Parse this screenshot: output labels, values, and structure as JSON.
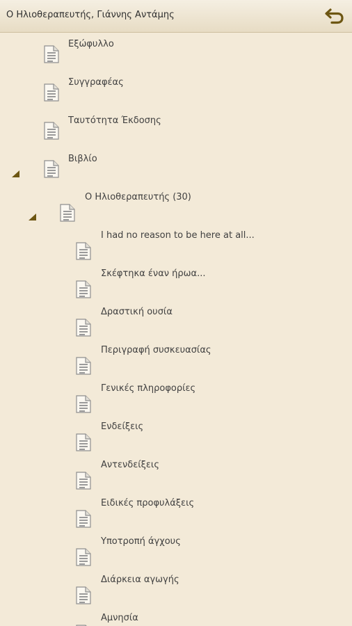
{
  "header": {
    "title": "Ο Ηλιοθεραπευτής, Γιάννης Αντάμης",
    "back_icon": "back-arrow-icon",
    "accent_color": "#6d5612"
  },
  "toc": {
    "items": [
      {
        "label": "Εξώφυλλο",
        "level": 0,
        "expanded": null
      },
      {
        "label": "Συγγραφέας",
        "level": 0,
        "expanded": null
      },
      {
        "label": "Ταυτότητα Έκδοσης",
        "level": 0,
        "expanded": null
      },
      {
        "label": "Βιβλίο",
        "level": 0,
        "expanded": true
      },
      {
        "label": "Ο Ηλιοθεραπευτής (30)",
        "level": 1,
        "expanded": true
      },
      {
        "label": "I had no reason to be here at all...",
        "level": 2,
        "expanded": null
      },
      {
        "label": "Σκέφτηκα έναν ήρωα...",
        "level": 2,
        "expanded": null
      },
      {
        "label": "Δραστική ουσία",
        "level": 2,
        "expanded": null
      },
      {
        "label": "Περιγραφή συσκευασίας",
        "level": 2,
        "expanded": null
      },
      {
        "label": "Γενικές πληροφορίες",
        "level": 2,
        "expanded": null
      },
      {
        "label": "Ενδείξεις",
        "level": 2,
        "expanded": null
      },
      {
        "label": "Αντενδείξεις",
        "level": 2,
        "expanded": null
      },
      {
        "label": "Ειδικές προφυλάξεις",
        "level": 2,
        "expanded": null
      },
      {
        "label": "Υποτροπή άγχους",
        "level": 2,
        "expanded": null
      },
      {
        "label": "Διάρκεια αγωγής",
        "level": 2,
        "expanded": null
      },
      {
        "label": "Αμνησία",
        "level": 2,
        "expanded": null
      }
    ]
  }
}
